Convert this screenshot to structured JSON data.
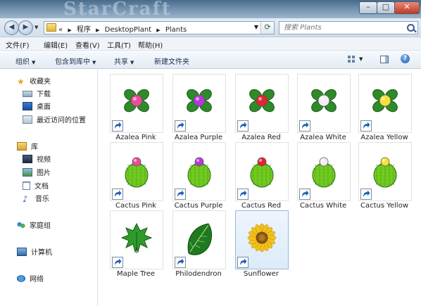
{
  "titlebar": {
    "banner_text": "StarCraft"
  },
  "window_controls": {
    "minimize": "–",
    "maximize": "□",
    "close": "✕"
  },
  "address": {
    "overflow": "«",
    "crumbs": [
      "程序",
      "DesktopPlant",
      "Plants"
    ],
    "search_placeholder": "搜索 Plants"
  },
  "menu": [
    "文件(F)",
    "编辑(E)",
    "查看(V)",
    "工具(T)",
    "帮助(H)"
  ],
  "toolbar": {
    "organize": "组织",
    "include_in_library": "包含到库中",
    "share": "共享",
    "new_folder": "新建文件夹"
  },
  "nav": {
    "favorites": "收藏夹",
    "downloads": "下载",
    "desktop": "桌面",
    "recent": "最近访问的位置",
    "libraries": "库",
    "videos": "视频",
    "pictures": "图片",
    "documents": "文档",
    "music": "音乐",
    "homegroup": "家庭组",
    "computer": "计算机",
    "network": "网络"
  },
  "files": [
    {
      "name": "Azalea Pink",
      "kind": "azalea",
      "color": "#ee4a9e"
    },
    {
      "name": "Azalea Purple",
      "kind": "azalea",
      "color": "#b23ad8"
    },
    {
      "name": "Azalea Red",
      "kind": "azalea",
      "color": "#e02430"
    },
    {
      "name": "Azalea White",
      "kind": "azalea",
      "color": "#f0f0f0"
    },
    {
      "name": "Azalea Yellow",
      "kind": "azalea",
      "color": "#f2e23a"
    },
    {
      "name": "Cactus Pink",
      "kind": "cactus",
      "color": "#ee4a9e"
    },
    {
      "name": "Cactus Purple",
      "kind": "cactus",
      "color": "#b23ad8"
    },
    {
      "name": "Cactus Red",
      "kind": "cactus",
      "color": "#e02430"
    },
    {
      "name": "Cactus White",
      "kind": "cactus",
      "color": "#f0f0f0"
    },
    {
      "name": "Cactus Yellow",
      "kind": "cactus",
      "color": "#f2e23a"
    },
    {
      "name": "Maple Tree",
      "kind": "maple",
      "color": "#2f9a2a"
    },
    {
      "name": "Philodendron",
      "kind": "philodendron",
      "color": "#1f7a1f"
    },
    {
      "name": "Sunflower",
      "kind": "sunflower",
      "color": "#f2c21a",
      "selected": true
    }
  ]
}
